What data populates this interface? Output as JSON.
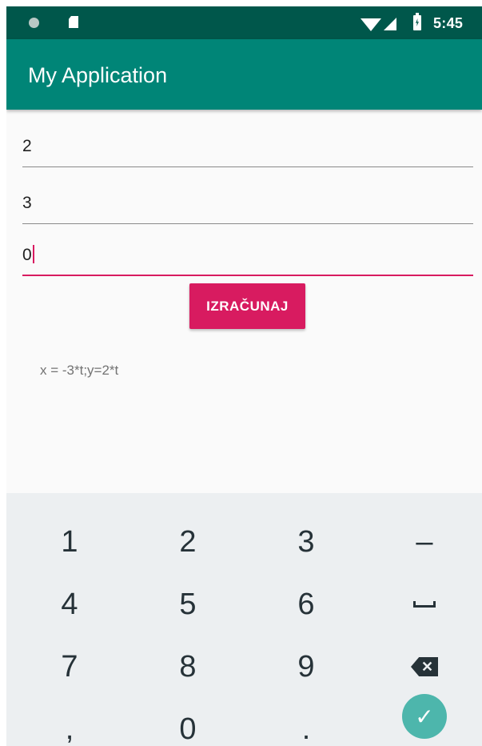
{
  "status_bar": {
    "time": "5:45",
    "icons": [
      "notification-dot-icon",
      "sd-card-icon",
      "wifi-icon",
      "cell-signal-icon",
      "battery-charging-icon"
    ]
  },
  "app_bar": {
    "title": "My Application"
  },
  "form": {
    "fields": [
      {
        "value": "2"
      },
      {
        "value": "3"
      },
      {
        "value": "0",
        "focused": true
      }
    ],
    "button_label": "IZRAČUNAJ",
    "result": "x = -3*t;y=2*t"
  },
  "keyboard": {
    "rows": [
      [
        "1",
        "2",
        "3",
        "–"
      ],
      [
        "4",
        "5",
        "6",
        "space"
      ],
      [
        "7",
        "8",
        "9",
        "backspace"
      ],
      [
        ",",
        "0",
        ".",
        "done"
      ]
    ]
  },
  "colors": {
    "status_bar": "#00574b",
    "app_bar": "#008577",
    "accent": "#d81b60",
    "keyboard_bg": "#eceff1",
    "done_key": "#4db6ac"
  }
}
